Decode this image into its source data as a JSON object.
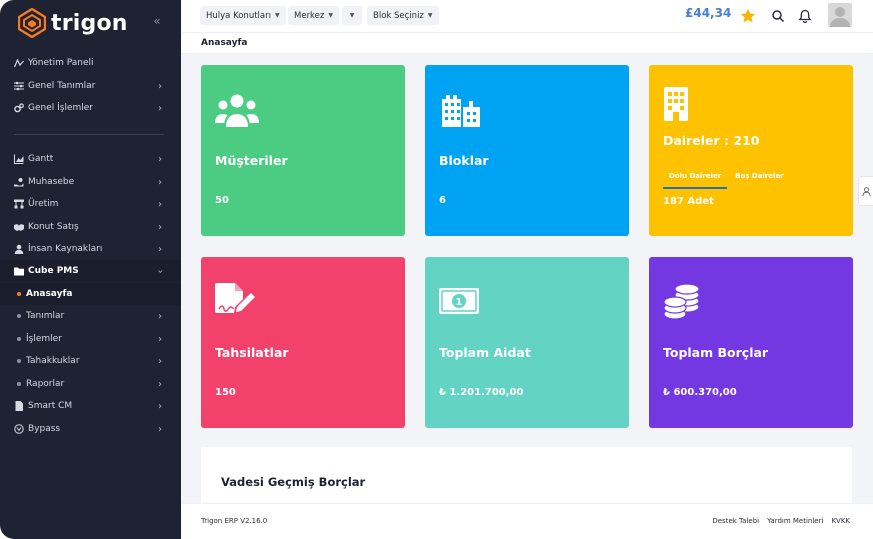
{
  "brand": {
    "name": "trigon",
    "accent": "#f47b20"
  },
  "sidebar": {
    "items": [
      {
        "label": "Yönetim Paneli",
        "icon": "chart-line-icon"
      },
      {
        "label": "Genel Tanımlar",
        "icon": "sliders-icon"
      },
      {
        "label": "Genel İşlemler",
        "icon": "cogs-icon"
      },
      {
        "label": "Gantt",
        "icon": "chart-area-icon"
      },
      {
        "label": "Muhasebe",
        "icon": "hand-coin-icon"
      },
      {
        "label": "Üretim",
        "icon": "network-icon"
      },
      {
        "label": "Konut Satış",
        "icon": "handshake-icon"
      },
      {
        "label": "İnsan Kaynakları",
        "icon": "user-icon"
      },
      {
        "label": "Cube PMS",
        "icon": "folder-icon"
      },
      {
        "label": "Anasayfa"
      },
      {
        "label": "Tanımlar"
      },
      {
        "label": "İşlemler"
      },
      {
        "label": "Tahakkuklar"
      },
      {
        "label": "Raporlar"
      },
      {
        "label": "Smart CM",
        "icon": "document-icon"
      },
      {
        "label": "Bypass",
        "icon": "bypass-icon"
      }
    ]
  },
  "header": {
    "selects": [
      "Hulya Konutları",
      "Merkez",
      "",
      "Blok Seçiniz"
    ],
    "balance": "£44,34"
  },
  "breadcrumb": "Anasayfa",
  "cards": [
    {
      "title": "Müşteriler",
      "value": "50",
      "color": "#4ccc82",
      "icon": "users-icon"
    },
    {
      "title": "Bloklar",
      "value": "6",
      "color": "#00a2f2",
      "icon": "city-icon"
    },
    {
      "title": "Daireler : 210",
      "color": "#fec200",
      "icon": "building-icon",
      "tabs": [
        "Dolu Daireler",
        "Boş Daireler"
      ],
      "value": "187 Adet"
    },
    {
      "title": "Tahsilatlar",
      "value": "150",
      "color": "#f2426b",
      "icon": "file-signature-icon"
    },
    {
      "title": "Toplam Aidat",
      "value": "₺ 1.201.700,00",
      "color": "#63d4c4",
      "icon": "money-bill-icon"
    },
    {
      "title": "Toplam Borçlar",
      "value": "₺ 600.370,00",
      "color": "#7338e2",
      "icon": "coins-icon"
    }
  ],
  "panel": {
    "title": "Vadesi Geçmiş Borçlar"
  },
  "footer": {
    "version": "Trigon ERP V2.16.0",
    "links": [
      "Destek Talebi",
      "Yardım Metinleri",
      "KVKK"
    ]
  }
}
